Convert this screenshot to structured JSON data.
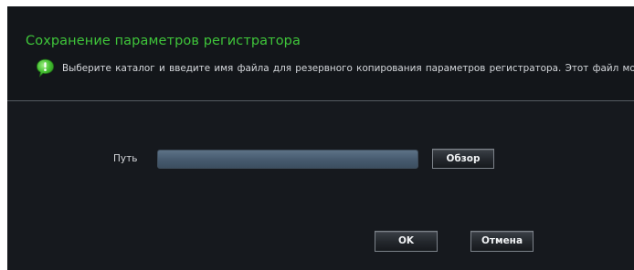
{
  "dialog": {
    "title": "Сохранение параметров регистратора",
    "info_icon": "info-bubble-icon",
    "info_text": "Выберите каталог и введите имя файла для резервного копирования параметров регистратора. Этот файл можно",
    "path_label": "Путь",
    "path_value": "",
    "browse_label": "Обзор",
    "ok_label": "OK",
    "cancel_label": "Отмена"
  },
  "colors": {
    "background": "#16191e",
    "title": "#3fc53a",
    "info_icon": "#4bc43a",
    "text": "#d6d9dd"
  }
}
